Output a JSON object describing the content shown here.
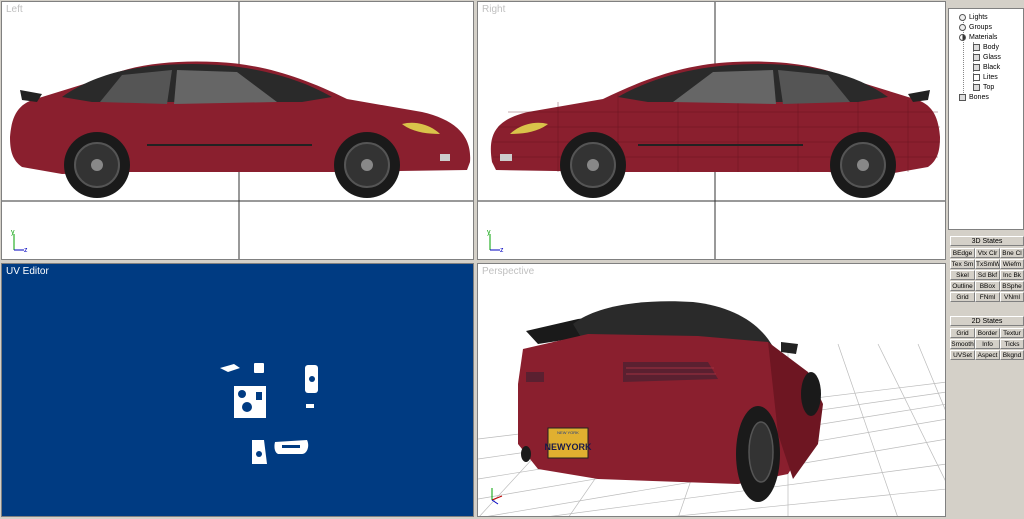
{
  "viewports": {
    "left": {
      "title": "Left",
      "axis_y": "y",
      "axis_z": "z"
    },
    "right": {
      "title": "Right",
      "axis_y": "y",
      "axis_z": "z"
    },
    "uv": {
      "title": "UV Editor"
    },
    "perspective": {
      "title": "Perspective",
      "plate_state": "NEW YORK",
      "plate_number": "NEWYORK"
    }
  },
  "scene_tree": {
    "items": [
      {
        "label": "Lights",
        "icon": "light-icon"
      },
      {
        "label": "Groups",
        "icon": "groups-icon"
      },
      {
        "label": "Materials",
        "icon": "materials-icon"
      },
      {
        "label": "Body",
        "icon": "material-swatch-icon"
      },
      {
        "label": "Glass",
        "icon": "material-swatch-icon"
      },
      {
        "label": "Black",
        "icon": "material-swatch-icon"
      },
      {
        "label": "Lites",
        "icon": "texture-icon"
      },
      {
        "label": "Top",
        "icon": "material-swatch-icon"
      },
      {
        "label": "Bones",
        "icon": "bones-icon"
      }
    ]
  },
  "states_3d": {
    "title": "3D States",
    "buttons": [
      "BEdge",
      "Vtx Clr",
      "Bne Cl",
      "Tex Sm",
      "TxSmlWr",
      "Wiefm",
      "Skel",
      "Sd Bkf",
      "Inc Bk",
      "Outline",
      "BBox",
      "BSphe",
      "Grid",
      "FNml",
      "VNml"
    ]
  },
  "states_2d": {
    "title": "2D States",
    "buttons": [
      "Grid",
      "Border",
      "Textur",
      "Smooth",
      "Info",
      "Ticks",
      "UVSet",
      "Aspect",
      "Bkgnd"
    ]
  },
  "colors": {
    "car_body": "#8a1f2e",
    "uv_background": "#003b82",
    "panel": "#d4d0c8"
  }
}
